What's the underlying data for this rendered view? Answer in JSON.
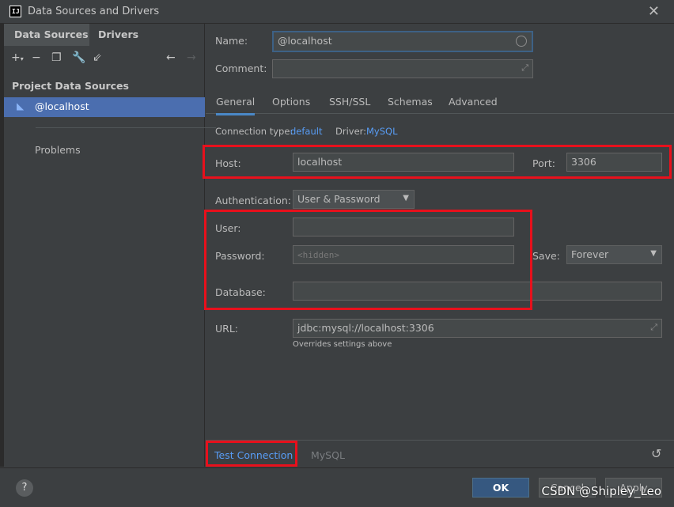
{
  "window": {
    "title": "Data Sources and Drivers",
    "app_icon_text": "IJ"
  },
  "left": {
    "tabs": [
      "Data Sources",
      "Drivers"
    ],
    "section_title": "Project Data Sources",
    "items": [
      {
        "label": "@localhost"
      }
    ],
    "problems_label": "Problems"
  },
  "form": {
    "name_label": "Name:",
    "name_value": "@localhost",
    "comment_label": "Comment:",
    "comment_value": "",
    "tabs": [
      "General",
      "Options",
      "SSH/SSL",
      "Schemas",
      "Advanced"
    ],
    "connection_type_label": "Connection type:",
    "connection_type_value": "default",
    "driver_label": "Driver:",
    "driver_value": "MySQL",
    "host_label": "Host:",
    "host_value": "localhost",
    "port_label": "Port:",
    "port_value": "3306",
    "auth_label": "Authentication:",
    "auth_value": "User & Password",
    "user_label": "User:",
    "user_value": "",
    "password_label": "Password:",
    "password_placeholder": "<hidden>",
    "save_label": "Save:",
    "save_value": "Forever",
    "database_label": "Database:",
    "database_value": "",
    "url_label": "URL:",
    "url_value": "jdbc:mysql://localhost:3306",
    "url_hint": "Overrides settings above"
  },
  "bottom": {
    "test_connection": "Test Connection",
    "driver_name": "MySQL"
  },
  "footer": {
    "help": "?",
    "ok": "OK",
    "cancel": "Cancel",
    "apply": "Apply",
    "watermark": "CSDN @Shipley_Leo"
  },
  "colors": {
    "accent": "#4b6eaf",
    "highlight": "#e8101c",
    "link": "#589df6"
  }
}
